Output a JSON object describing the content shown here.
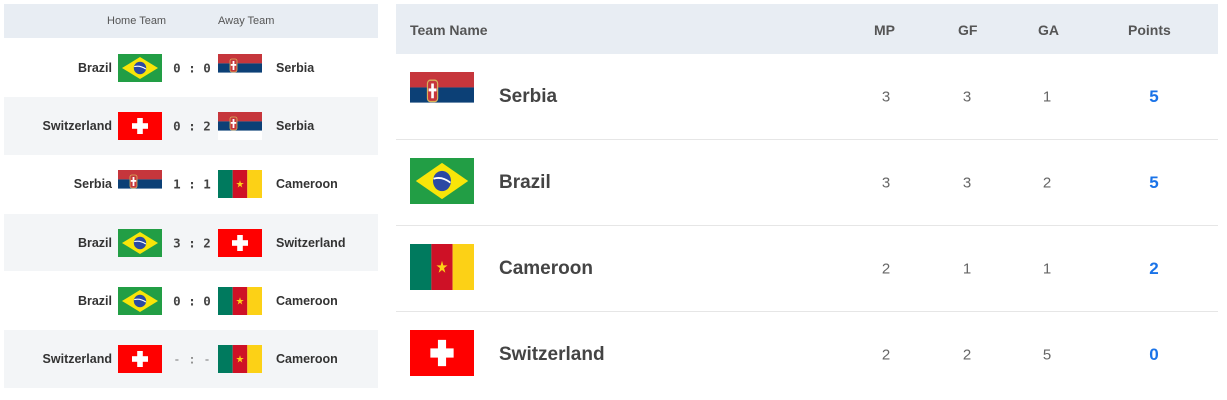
{
  "matches": {
    "header": {
      "home_label": "Home Team",
      "away_label": "Away Team"
    },
    "rows": [
      {
        "home": "Brazil",
        "home_flag": "flag-brazil",
        "score": "0 : 0",
        "away": "Serbia",
        "away_flag": "flag-serbia"
      },
      {
        "home": "Switzerland",
        "home_flag": "flag-switzerland",
        "score": "0 : 2",
        "away": "Serbia",
        "away_flag": "flag-serbia"
      },
      {
        "home": "Serbia",
        "home_flag": "flag-serbia",
        "score": "1 : 1",
        "away": "Cameroon",
        "away_flag": "flag-cameroon"
      },
      {
        "home": "Brazil",
        "home_flag": "flag-brazil",
        "score": "3 : 2",
        "away": "Switzerland",
        "away_flag": "flag-switzerland"
      },
      {
        "home": "Brazil",
        "home_flag": "flag-brazil",
        "score": "0 : 0",
        "away": "Cameroon",
        "away_flag": "flag-cameroon"
      },
      {
        "home": "Switzerland",
        "home_flag": "flag-switzerland",
        "score": "- : -",
        "away": "Cameroon",
        "away_flag": "flag-cameroon"
      }
    ]
  },
  "standings": {
    "header": {
      "team": "Team Name",
      "mp": "MP",
      "gf": "GF",
      "ga": "GA",
      "points": "Points"
    },
    "rows": [
      {
        "team": "Serbia",
        "flag": "flag-serbia",
        "mp": "3",
        "gf": "3",
        "ga": "1",
        "points": "5"
      },
      {
        "team": "Brazil",
        "flag": "flag-brazil",
        "mp": "3",
        "gf": "3",
        "ga": "2",
        "points": "5"
      },
      {
        "team": "Cameroon",
        "flag": "flag-cameroon",
        "mp": "2",
        "gf": "1",
        "ga": "1",
        "points": "2"
      },
      {
        "team": "Switzerland",
        "flag": "flag-switzerland",
        "mp": "2",
        "gf": "2",
        "ga": "5",
        "points": "0"
      }
    ]
  },
  "colors": {
    "points": "#1a73e8",
    "header_bg": "#e8edf3",
    "alt_row_bg": "#f3f5f7"
  }
}
